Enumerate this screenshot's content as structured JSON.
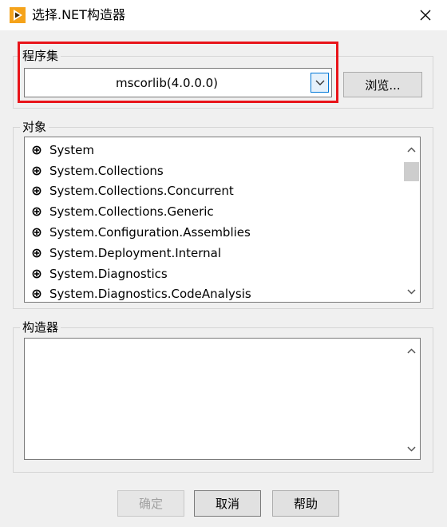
{
  "window": {
    "title": "选择.NET构造器",
    "app_icon": "labview-run-arrow-icon",
    "close_icon": "close-icon"
  },
  "assembly_group": {
    "label": "程序集",
    "selected_value": "mscorlib(4.0.0.0)",
    "browse_label": "浏览..."
  },
  "objects_group": {
    "label": "对象",
    "items": [
      "System",
      "System.Collections",
      "System.Collections.Concurrent",
      "System.Collections.Generic",
      "System.Configuration.Assemblies",
      "System.Deployment.Internal",
      "System.Diagnostics",
      "System.Diagnostics.CodeAnalysis"
    ]
  },
  "constructors_group": {
    "label": "构造器",
    "items": []
  },
  "footer": {
    "ok_label": "确定",
    "cancel_label": "取消",
    "help_label": "帮助"
  },
  "colors": {
    "highlight": "#e8141a",
    "accent": "#0078d7",
    "app_icon": "#f5a31a"
  }
}
